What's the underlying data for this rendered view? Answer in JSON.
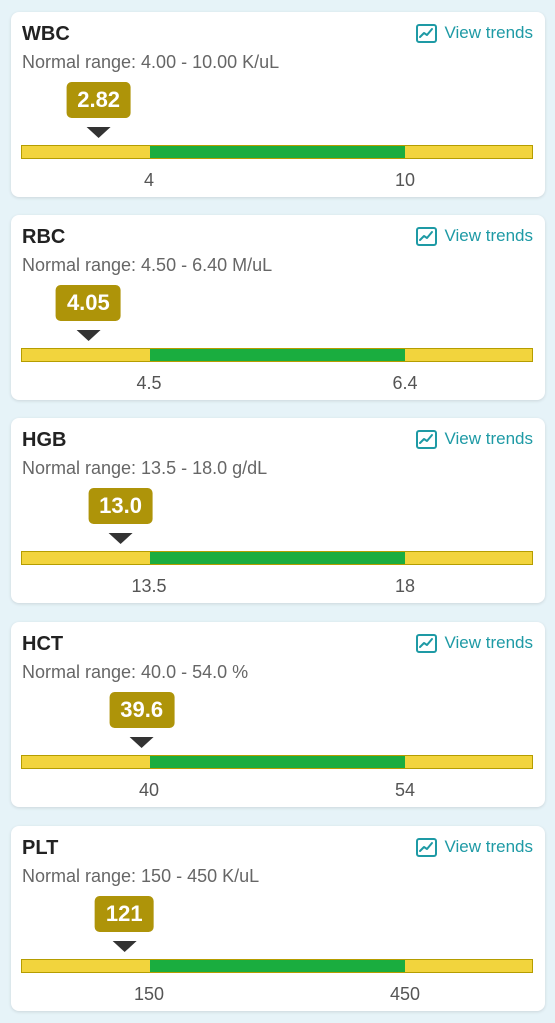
{
  "view_trends_label": "View trends",
  "icon": "trend-chart-icon",
  "colors": {
    "background": "#e6f3f8",
    "badge": "#ae9409",
    "bar_low": "#f2d43d",
    "bar_normal": "#1aad3f",
    "bar_high": "#f2d43d",
    "link": "#1e9aa5"
  },
  "tests": [
    {
      "name": "WBC",
      "range_text": "Normal range: 4.00 - 10.00 K/uL",
      "value": "2.82",
      "low_label": "4",
      "high_label": "10",
      "value_num": 2.82,
      "low": 4,
      "high": 10
    },
    {
      "name": "RBC",
      "range_text": "Normal range: 4.50 - 6.40 M/uL",
      "value": "4.05",
      "low_label": "4.5",
      "high_label": "6.4",
      "value_num": 4.05,
      "low": 4.5,
      "high": 6.4
    },
    {
      "name": "HGB",
      "range_text": "Normal range: 13.5 - 18.0 g/dL",
      "value": "13.0",
      "low_label": "13.5",
      "high_label": "18",
      "value_num": 13.0,
      "low": 13.5,
      "high": 18
    },
    {
      "name": "HCT",
      "range_text": "Normal range: 40.0 - 54.0 %",
      "value": "39.6",
      "low_label": "40",
      "high_label": "54",
      "value_num": 39.6,
      "low": 40,
      "high": 54
    },
    {
      "name": "PLT",
      "range_text": "Normal range: 150 - 450 K/uL",
      "value": "121",
      "low_label": "150",
      "high_label": "450",
      "value_num": 121,
      "low": 150,
      "high": 450
    }
  ]
}
